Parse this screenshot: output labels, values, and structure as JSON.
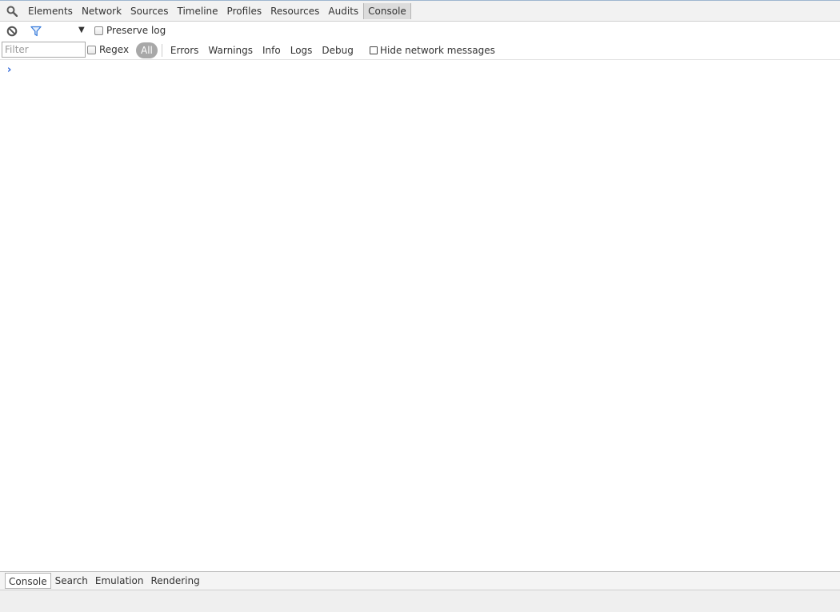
{
  "main_tabs": [
    {
      "label": "Elements"
    },
    {
      "label": "Network"
    },
    {
      "label": "Sources"
    },
    {
      "label": "Timeline"
    },
    {
      "label": "Profiles"
    },
    {
      "label": "Resources"
    },
    {
      "label": "Audits"
    },
    {
      "label": "Console",
      "active": true
    }
  ],
  "toolbar": {
    "preserve_log_label": "Preserve log",
    "preserve_log_checked": false
  },
  "filter": {
    "placeholder": "Filter",
    "regex_label": "Regex",
    "levels": [
      "All",
      "Errors",
      "Warnings",
      "Info",
      "Logs",
      "Debug"
    ],
    "active_level": "All",
    "hide_network_label": "Hide network messages"
  },
  "console": {
    "prompt": "›"
  },
  "drawer_tabs": [
    {
      "label": "Console",
      "active": true
    },
    {
      "label": "Search"
    },
    {
      "label": "Emulation"
    },
    {
      "label": "Rendering"
    }
  ],
  "colors": {
    "accent": "#2a63d8",
    "active_level_bg": "#a8a8a8"
  },
  "icons": {
    "search": "search-icon",
    "clear": "clear-console-icon",
    "filter": "filter-icon",
    "dropdown": "dropdown-arrow-icon"
  }
}
